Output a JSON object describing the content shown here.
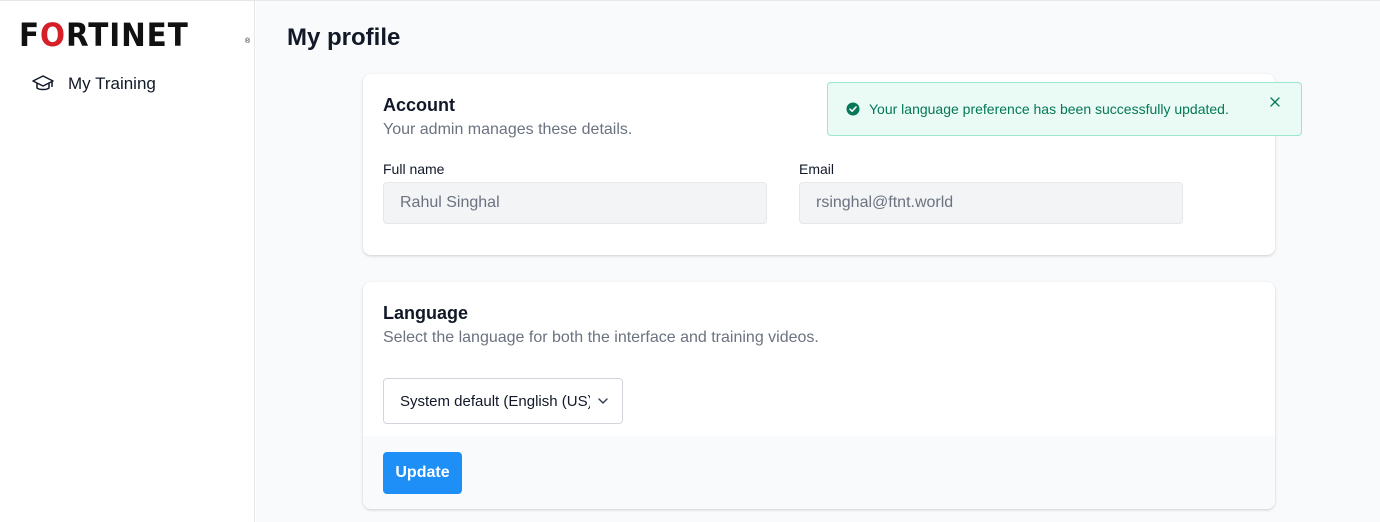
{
  "brand": {
    "logo_text": "FORTINET",
    "logo_o": "O",
    "registered": "®",
    "accent": "#d5202a"
  },
  "sidebar": {
    "items": [
      {
        "label": "My Training",
        "icon": "graduation-cap-icon"
      }
    ]
  },
  "page": {
    "title": "My profile"
  },
  "account": {
    "title": "Account",
    "subtitle": "Your admin manages these details.",
    "full_name_label": "Full name",
    "full_name_value": "Rahul Singhal",
    "email_label": "Email",
    "email_value": "rsinghal@ftnt.world"
  },
  "language": {
    "title": "Language",
    "subtitle": "Select the language for both the interface and training videos.",
    "selected": "System default (English (US))",
    "update_label": "Update"
  },
  "toast": {
    "message": "Your language preference has been successfully updated.",
    "icon": "check-circle-icon",
    "color": "#047857"
  },
  "colors": {
    "primary": "#1d8ff7",
    "toast_bg": "#eafaf5",
    "toast_border": "#99e6d1"
  }
}
